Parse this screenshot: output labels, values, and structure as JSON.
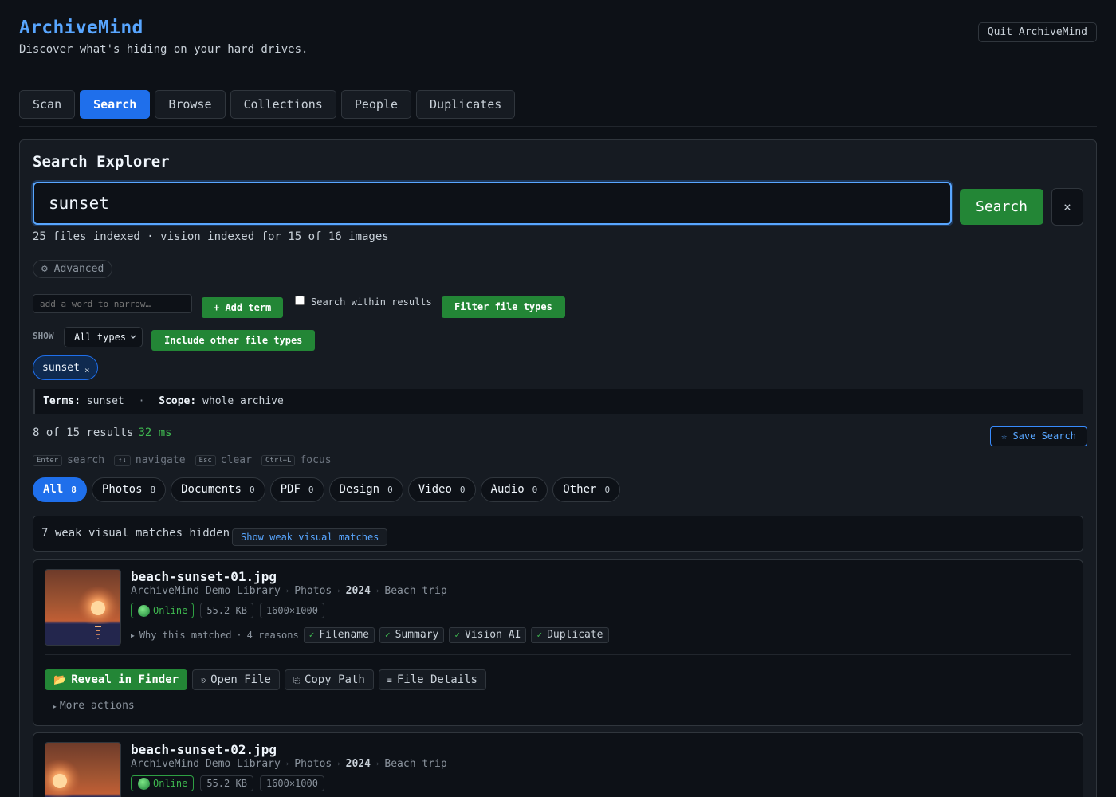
{
  "app": {
    "title": "ArchiveMind",
    "subtitle": "Discover what's hiding on your hard drives.",
    "quit_label": "Quit ArchiveMind"
  },
  "nav": {
    "tabs": [
      {
        "label": "Scan"
      },
      {
        "label": "Search"
      },
      {
        "label": "Browse"
      },
      {
        "label": "Collections"
      },
      {
        "label": "People"
      },
      {
        "label": "Duplicates"
      }
    ],
    "active": "Search"
  },
  "search": {
    "panel_title": "Search Explorer",
    "query": "sunset",
    "button_label": "Search",
    "clear_icon": "×",
    "index_status": "25 files indexed · vision indexed for 15 of 16 images",
    "advanced_label": "⚙ Advanced",
    "narrow_placeholder": "add a word to narrow…",
    "add_term_label": "+ Add term",
    "within_results_label": "Search within results",
    "within_results_checked": false,
    "filter_types_label": "Filter file types",
    "show_label": "SHOW",
    "type_select_value": "All types",
    "include_other_label": "Include other file types",
    "chips": [
      {
        "label": "sunset",
        "remove": "×"
      }
    ],
    "terms_label": "Terms:",
    "terms_value": "sunset",
    "scope_label": "Scope:",
    "scope_value": "whole archive",
    "results_count": "8 of 15 results",
    "elapsed": "32 ms",
    "save_search_label": "☆ Save Search"
  },
  "shortcuts": [
    {
      "key": "Enter",
      "label": "search"
    },
    {
      "key": "↑↓",
      "label": "navigate"
    },
    {
      "key": "Esc",
      "label": "clear"
    },
    {
      "key": "Ctrl+L",
      "label": "focus"
    }
  ],
  "filters": [
    {
      "label": "All",
      "count": "8",
      "active": true
    },
    {
      "label": "Photos",
      "count": "8"
    },
    {
      "label": "Documents",
      "count": "0"
    },
    {
      "label": "PDF",
      "count": "0"
    },
    {
      "label": "Design",
      "count": "0"
    },
    {
      "label": "Video",
      "count": "0"
    },
    {
      "label": "Audio",
      "count": "0"
    },
    {
      "label": "Other",
      "count": "0"
    }
  ],
  "weak": {
    "text": "7 weak visual matches hidden",
    "button_label": "Show weak visual matches"
  },
  "results": [
    {
      "file_name": "beach-sunset-01.jpg",
      "path": [
        "ArchiveMind Demo Library",
        "Photos",
        "2024",
        "Beach trip"
      ],
      "status": "Online",
      "size": "55.2 KB",
      "dimensions": "1600×1000",
      "why_label": "Why this matched",
      "reasons_count": "4 reasons",
      "reasons": [
        "Filename",
        "Summary",
        "Vision AI",
        "Duplicate"
      ],
      "actions": {
        "reveal": "Reveal in Finder",
        "open": "Open File",
        "copy": "Copy Path",
        "details": "File Details",
        "more": "More actions"
      }
    },
    {
      "file_name": "beach-sunset-02.jpg",
      "path": [
        "ArchiveMind Demo Library",
        "Photos",
        "2024",
        "Beach trip"
      ],
      "status": "Online",
      "size": "55.2 KB",
      "dimensions": "1600×1000"
    }
  ]
}
